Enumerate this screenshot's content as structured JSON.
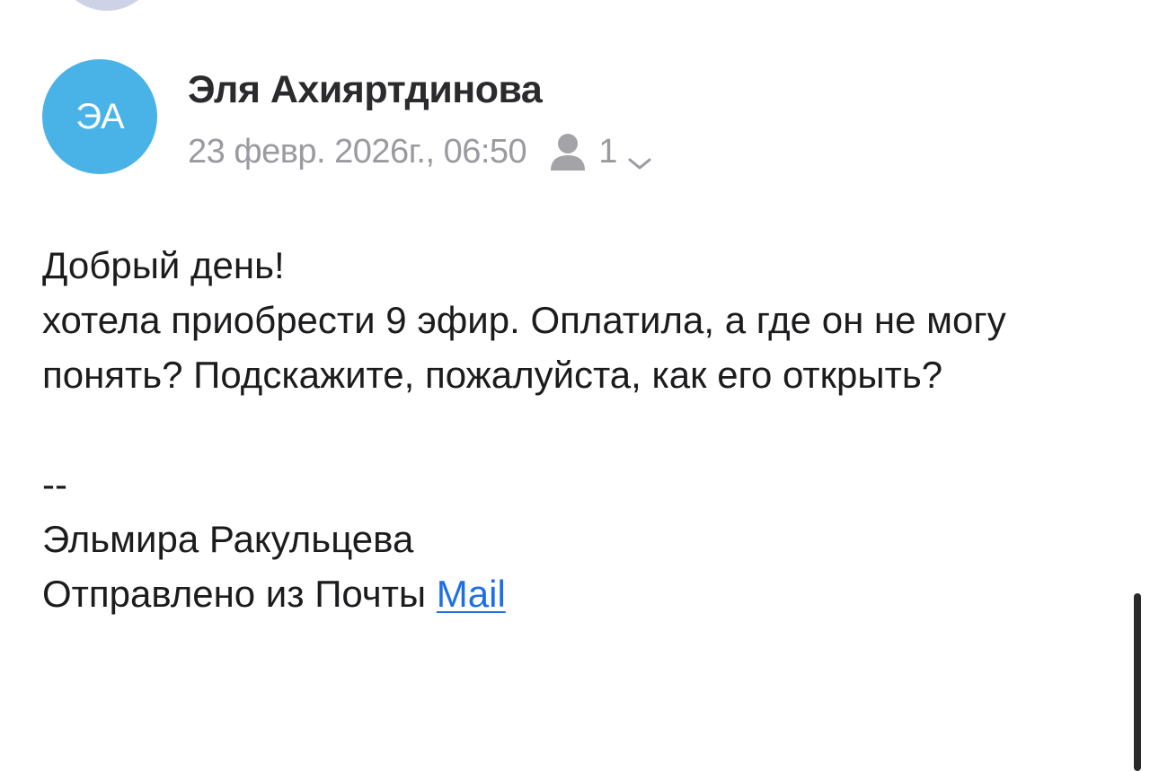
{
  "message": {
    "sender": {
      "initials": "ЭА",
      "name": "Эля Ахияртдинова",
      "avatar_color": "#49b3e8"
    },
    "meta": {
      "date": "23 февр. 2026г., 06:50",
      "recipient_icon": "person-icon",
      "recipients_count": "1",
      "expand_icon": "chevron-down-icon"
    },
    "body": {
      "greeting": "Добрый день!",
      "text": "хотела приобрести 9 эфир. Оплатила, а где он не могу понять? Подскажите, пожалуйста, как его открыть?",
      "separator": "--",
      "signature_name": "Эльмира Ракульцева",
      "sent_from": "Отправлено из Почты ",
      "link_text": "Mail"
    }
  },
  "colors": {
    "link": "#1d6fe8",
    "meta_text": "#9a9aa0",
    "body_text": "#1c1c1e"
  }
}
